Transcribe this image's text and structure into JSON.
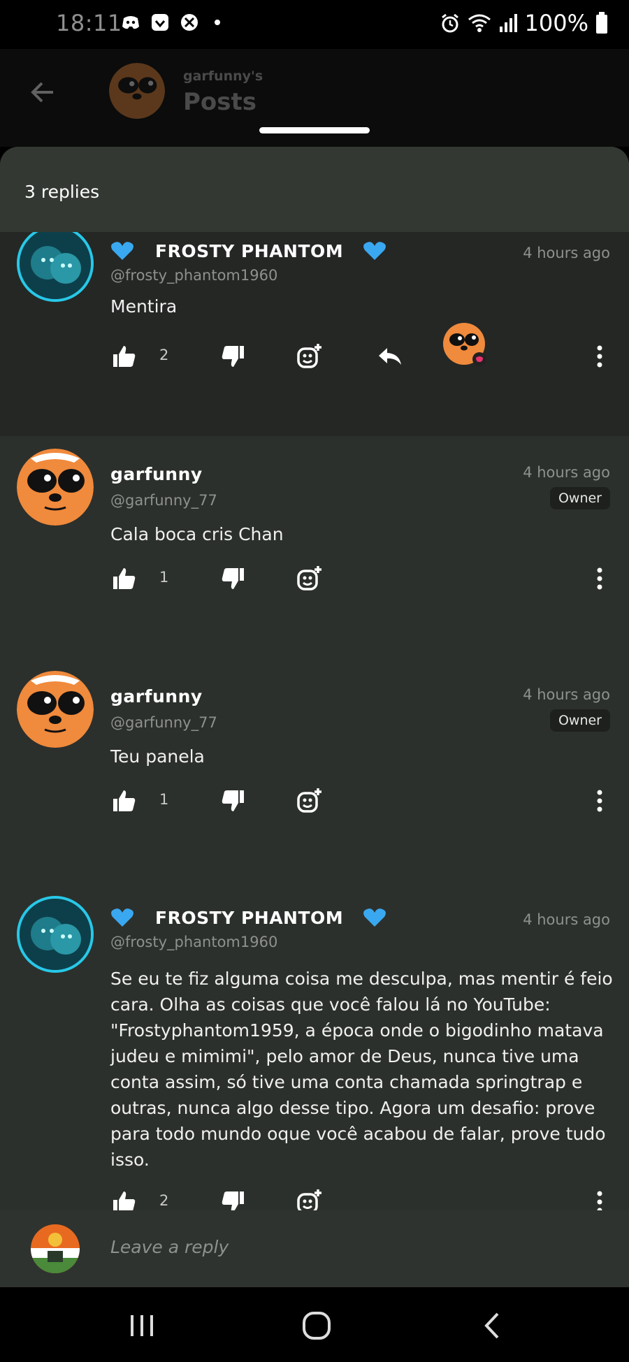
{
  "status_bar": {
    "time": "18:11",
    "battery": "100%"
  },
  "background_header": {
    "owner_label": "garfunny's",
    "title": "Posts"
  },
  "sheet": {
    "title": "3 replies"
  },
  "comments": [
    {
      "name": "FROSTY  PHANTOM",
      "handle": "@frosty_phantom1960",
      "time": "4 hours ago",
      "body": "Mentira",
      "likes": "2",
      "avatar": "frosty-avatar"
    },
    {
      "name": "garfunny",
      "handle": "@garfunny_77",
      "time": "4 hours ago",
      "badge": "Owner",
      "body": "Cala boca cris Chan",
      "likes": "1",
      "avatar": "garfunny-avatar"
    },
    {
      "name": "garfunny",
      "handle": "@garfunny_77",
      "time": "4 hours ago",
      "badge": "Owner",
      "body": "Teu panela",
      "likes": "1",
      "avatar": "garfunny-avatar"
    },
    {
      "name": "FROSTY  PHANTOM",
      "handle": "@frosty_phantom1960",
      "time": "4 hours ago",
      "body": "Se eu te fiz alguma coisa me desculpa, mas mentir é feio cara. Olha as coisas que você falou lá no YouTube: \"Frostyphantom1959, a época onde o bigodinho matava judeu e mimimi\", pelo amor de Deus, nunca tive uma conta assim, só tive uma conta chamada springtrap e outras, nunca algo desse tipo. Agora um desafio: prove para todo mundo oque você acabou de falar, prove tudo isso.",
      "likes": "2",
      "avatar": "frosty-avatar"
    }
  ],
  "reply_bar": {
    "placeholder": "Leave a reply"
  },
  "colors": {
    "accent_ring": "#28c8e8",
    "heart": "#3aa8f0",
    "sheet_bg": "#2c302c",
    "highlight_bg": "#252725"
  }
}
